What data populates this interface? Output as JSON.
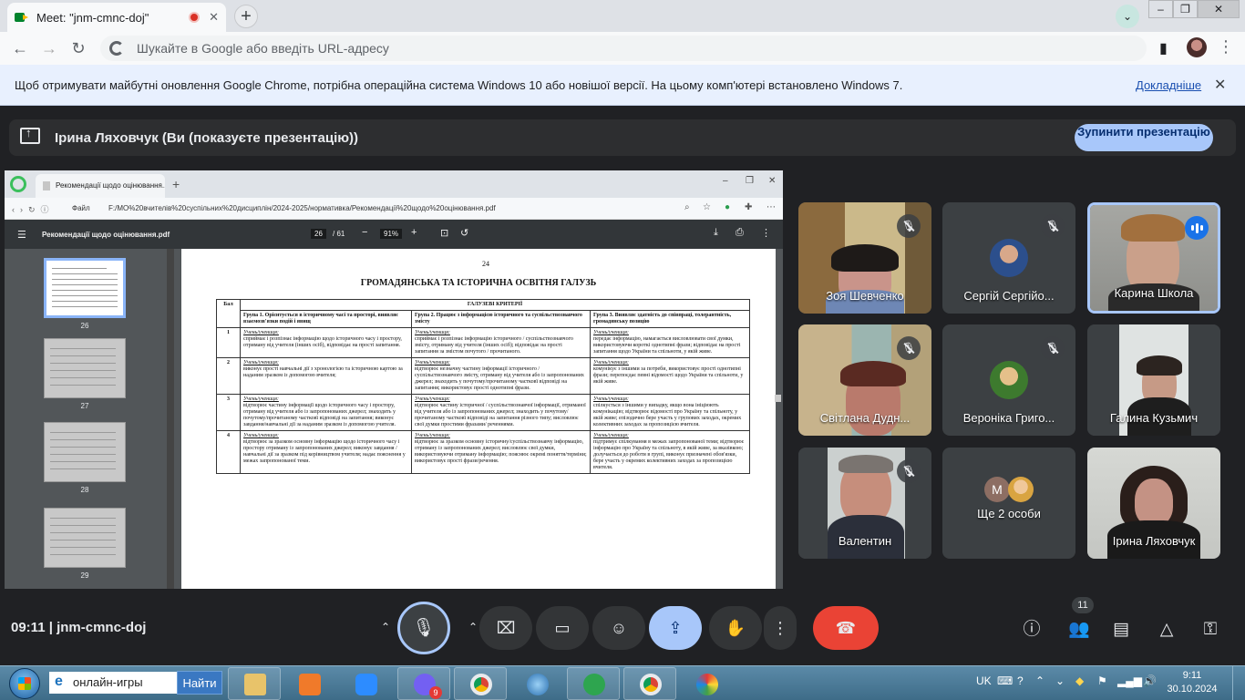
{
  "browser": {
    "tab_title": "Meet: \"jnm-cmnc-doj\"",
    "tab_close": "✕",
    "new_tab": "+",
    "omnibox_placeholder": "Шукайте в Google або введіть URL-адресу"
  },
  "infobar": {
    "message": "Щоб отримувати майбутні оновлення Google Chrome, потрібна операційна система Windows 10 або новішої версії. На цьому комп'ютері встановлено Windows 7.",
    "link": "Докладніше",
    "close": "✕"
  },
  "presenting": {
    "label": "Ірина Ляховчук (Ви (показуєте презентацію))",
    "stop_button": "Зупинити презентацію"
  },
  "shared_screen": {
    "tab_title": "Рекомендації щодо оцінювання...",
    "address_prefix": "Файл",
    "url": "F:/МО%20вчителів%20суспільних%20дисциплін/2024-2025/нормативка/Рекомендації%20щодо%20оцінювання.pdf",
    "pdf_name": "Рекомендації щодо оцінювання.pdf",
    "page_current": "26",
    "page_total": "/ 61",
    "zoom": "91%",
    "thumbnails": [
      "26",
      "27",
      "28",
      "29"
    ],
    "doc": {
      "page_number": "24",
      "title": "ГРОМАДЯНСЬКА ТА ІСТОРИЧНА ОСВІТНЯ ГАЛУЗЬ",
      "col_score": "Бал",
      "col_criteria": "ГАЛУЗЕВІ КРИТЕРІЇ",
      "group1": "Група 1. Орієнтується в історичному часі та просторі, виявляє взаємозв'язки подій і явищ",
      "group2": "Група 2. Працює з інформацією історичного та суспільствознавчого змісту",
      "group3": "Група 3. Виявляє здатність до співпраці, толерантність, громадянську позицію",
      "student_label": "Учень/учениця:",
      "rows": [
        {
          "score": "1",
          "c1": "сприймає і розпізнає інформацію щодо історичного часу і простору, отриману від учителя (інших осіб), відповідає на прості запитання.",
          "c2": "сприймає і розпізнає інформацію історичного / суспільствознавчого змісту, отриману від учителя (інших осіб); відповідає на прості запитання за змістом почутого / прочитаного.",
          "c3": "передає інформацію, намагається висловлювати свої думки, використовуючи короткі однотипні фрази; відповідає на прості запитання щодо України та спільноти, у якій живе."
        },
        {
          "score": "2",
          "c1": "виконує прості навчальні дії з хронологією та історичною картою за наданим зразком із допомогою вчителя;",
          "c2": "відтворює незначну частину інформації історичного / суспільствознавчого змісту, отриману від учителя або із запропонованих джерел; знаходить у почутому/прочитаному частковї відповіді на запитання; використовує прості однотипні фрази.",
          "c3": "комунікує з іншими за потреби, використовує прості однотипні фрази; перепоєдає певні відомості щодо України та спільноти, у якій живе."
        },
        {
          "score": "3",
          "c1": "відтворює частину інформації щодо історичного часу і простору, отриману від учителя або із запропонованих джерел; знаходить у почутому/прочитаному частковї відповіді на запитання; виконує завдання/навчальні дії за наданим зразком із допомогою учителя.",
          "c2": "відтворює частину історичної / суспільствознавчої інформації, отриманої від учителя або із запропонованих джерел; знаходить у почутому/прочитаному частковї відповіді на запитання різного типу; висловлює свої думки простими фразами/ реченнями.",
          "c3": "спілкується з іншими у випадку, якщо вона ініціюють комунікацію; відтворює відомості про Україну та спільноту, у якій живе; епізодично бере участь у групових заходах, окремих колективних заходах за пропозицією вчителя."
        },
        {
          "score": "4",
          "c1": "відтворює за зразком основну інформацію щодо історичного часу і простору отриману із запропонованих джерел; виконує завдання /навчальні дії за зразком під керівництвом учителя; надає пояснення у межах запропонованої теми.",
          "c2": "відтворює за зразком основну історичну/суспільствознавчу інформацію, отриману із запропонованих джерел; висловлює свої думки, використовуючи отриману інформацію; пояснює окремі поняття/терміни; використовує прості фрази/речення.",
          "c3": "підтримує спілкування в межах запропонованої теми; відтворює інформацію про Україну та спільноту, в якій живе, за вказівкою; долучається до роботи в групі, виконує призначені обов'язки, бере участь у окремих колективних заходах за пропозицією вчителя."
        }
      ]
    }
  },
  "participants": [
    {
      "name": "Зоя Шевченко",
      "muted": true
    },
    {
      "name": "Сергій Сергійо...",
      "muted": true
    },
    {
      "name": "Карина Школа",
      "speaking": true
    },
    {
      "name": "Світлана Дудн...",
      "muted": true
    },
    {
      "name": "Вероніка Григо...",
      "muted": true
    },
    {
      "name": "Галина Кузьмич"
    },
    {
      "name": "Валентин",
      "muted": true
    },
    {
      "name": "Ще 2 особи",
      "avatar_letter": "M"
    },
    {
      "name": "Ірина Ляховчук"
    }
  ],
  "callbar": {
    "meeting_info": "09:11 | jnm-cmnc-doj",
    "participants_count": "11",
    "colors": {
      "end_call": "#ea4335",
      "present_active": "#a8c7fa"
    }
  },
  "taskbar": {
    "search_text": "онлайн-игры",
    "search_button": "Найти",
    "viber_badge": "9",
    "lang": "UK",
    "time": "9:11",
    "date": "30.10.2024"
  }
}
